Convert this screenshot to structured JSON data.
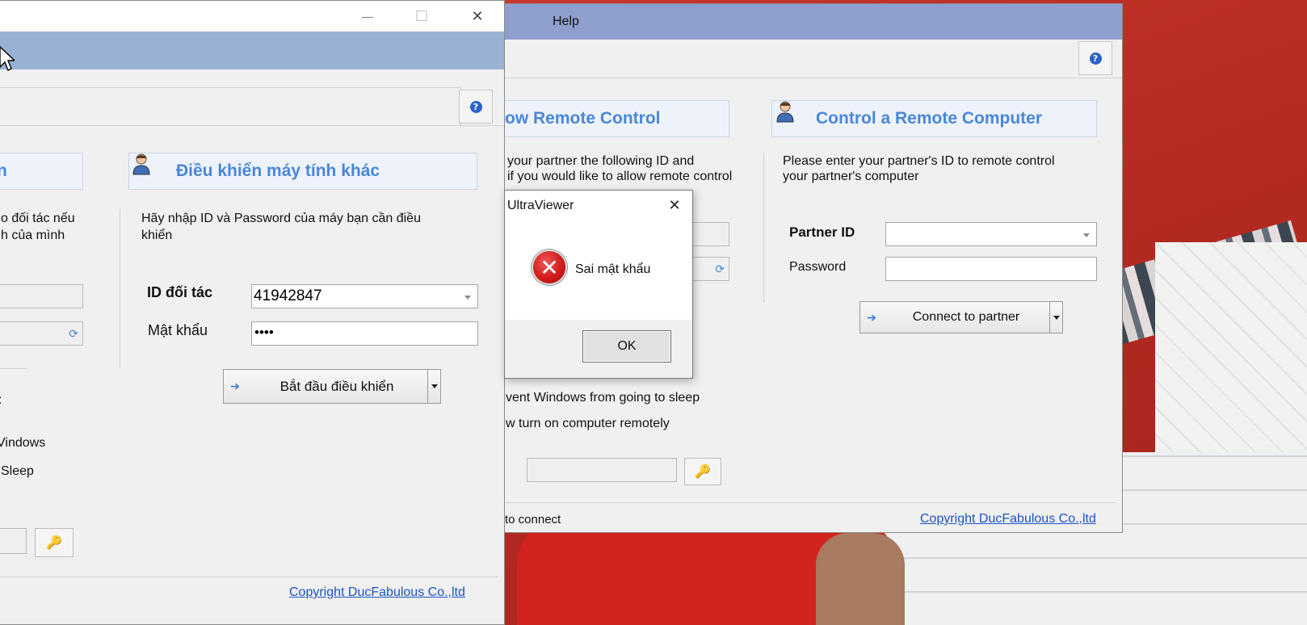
{
  "right_window": {
    "menu_help": "Help",
    "allow_heading": "ow Remote Control",
    "allow_text_line1": "your partner the following ID and",
    "allow_text_line2": "if you would like to allow remote control",
    "control_heading": "Control a Remote Computer",
    "control_text_line1": "Please enter your partner's ID to remote control",
    "control_text_line2": "your partner's computer",
    "partner_id_label": "Partner ID",
    "partner_id_value": "",
    "password_label": "Password",
    "password_value": "",
    "connect_button": "Connect to partner",
    "option_sleep": "vent Windows from going to sleep",
    "option_turn_on": "w turn on computer remotely",
    "status_text": "to connect",
    "copyright": "Copyright DucFabulous Co.,ltd"
  },
  "left_window": {
    "allow_heading_fragment": "n",
    "allow_text_line1": "o đối tác nếu",
    "allow_text_line2": "h của mình",
    "control_heading": "Điều khiển máy tính khác",
    "control_text_line1": "Hãy nhập ID và Password của máy bạn cần điều",
    "control_text_line2": "khiển",
    "partner_id_label": "ID đối tác",
    "partner_id_value": "41942847",
    "password_label": "Mật khẩu",
    "password_value": "••••",
    "start_button": "Bắt đầu điều khiển",
    "colon_fragment": ":",
    "option_windows": "Vindows",
    "option_sleep": "Sleep",
    "copyright": "Copyright DucFabulous Co.,ltd"
  },
  "dialog": {
    "title": "UltraViewer",
    "message": "Sai mật khẩu",
    "ok_button": "OK",
    "error_icon_glyph": "✕"
  },
  "icons": {
    "help": "?",
    "arrow": "➔",
    "key": "🔑",
    "refresh": "⟳",
    "close": "✕",
    "minimize": "—",
    "maximize": "☐"
  },
  "colors": {
    "menubar_right": "#8e9fcd",
    "menubar_left": "#99b1d3",
    "heading_blue": "#4a86d8",
    "link_blue": "#1a53c4",
    "error_red": "#d21b1b"
  }
}
